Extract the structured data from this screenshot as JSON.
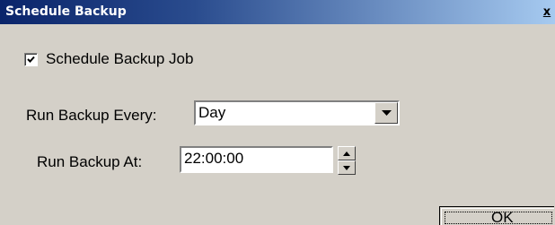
{
  "window": {
    "title": "Schedule Backup",
    "close_label": "x"
  },
  "schedule": {
    "checkbox_label": "Schedule Backup Job",
    "checked": true
  },
  "run_every": {
    "label": "Run Backup Every:",
    "value": "Day"
  },
  "run_at": {
    "label": "Run Backup At:",
    "value": "22:00:00"
  },
  "buttons": {
    "ok_label": "OK"
  }
}
